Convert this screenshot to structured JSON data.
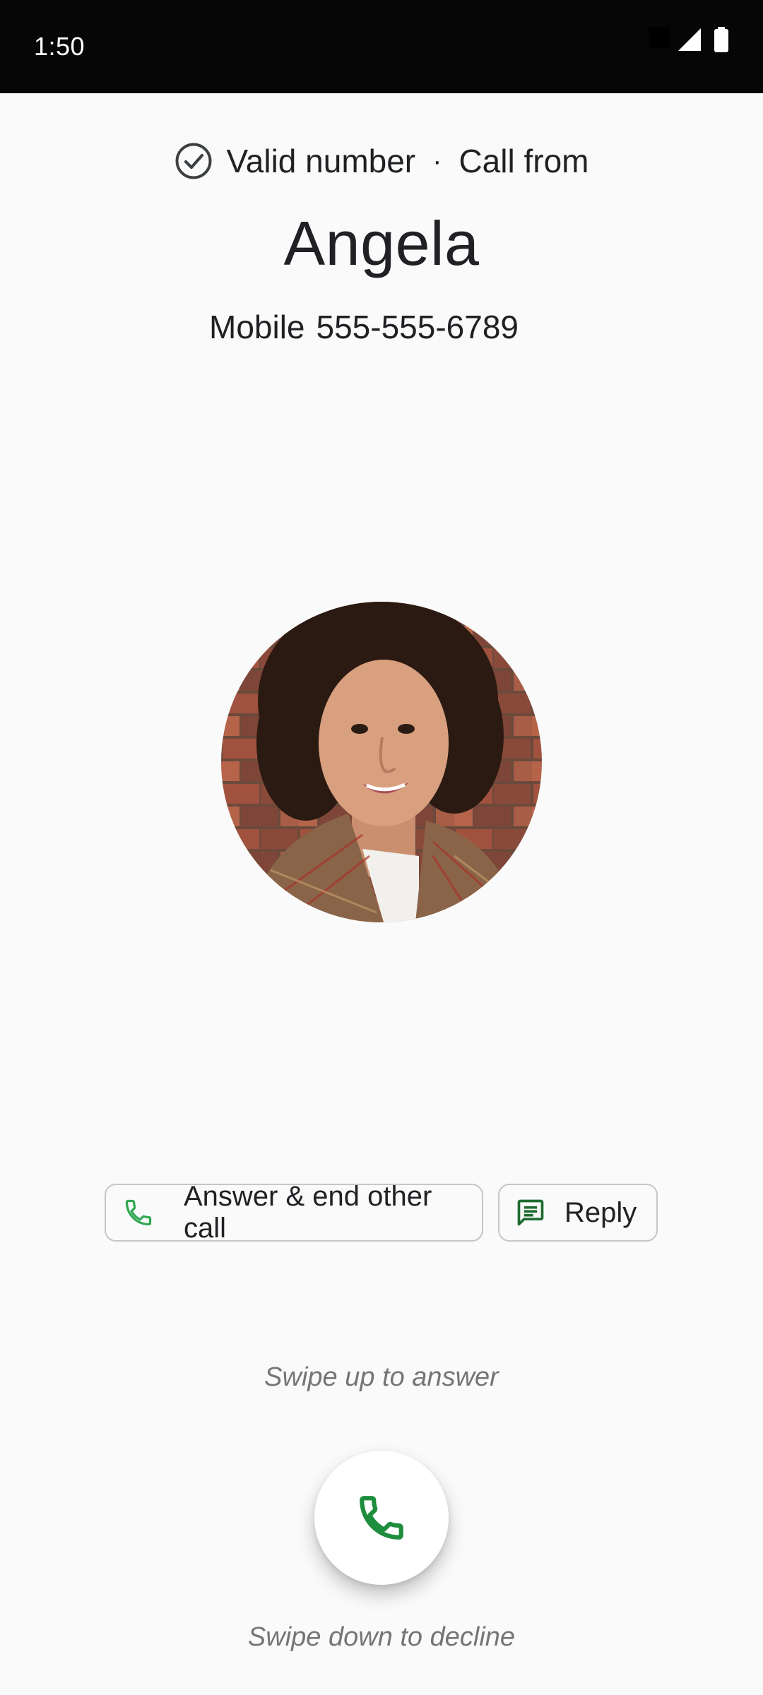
{
  "status_bar": {
    "time": "1:50",
    "icons": [
      "signal-icon",
      "battery-icon"
    ]
  },
  "caller": {
    "verification_icon": "check-circle-icon",
    "verification_label": "Valid number",
    "separator": "·",
    "call_label": "Call from",
    "name": "Angela",
    "number_type": "Mobile",
    "number": "555-555-6789",
    "avatar": "contact-photo"
  },
  "actions": {
    "answer_end_label": "Answer & end other call",
    "answer_end_icon": "phone-icon",
    "reply_label": "Reply",
    "reply_icon": "message-icon"
  },
  "swipe": {
    "up_hint": "Swipe up to answer",
    "down_hint": "Swipe down to decline",
    "answer_icon": "phone-icon"
  },
  "colors": {
    "accent_green": "#1e8e3e",
    "background": "#fafafa",
    "status_bar": "#060606",
    "hint_text": "#757575"
  }
}
